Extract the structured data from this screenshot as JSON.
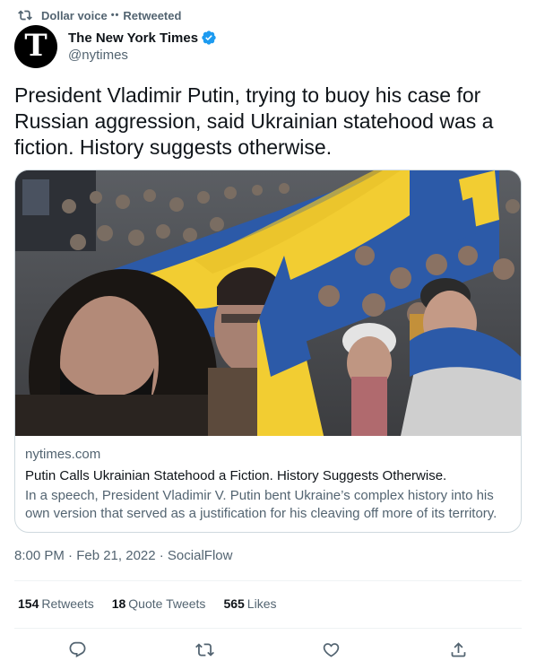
{
  "retweet_context": {
    "icon": "retweet-icon",
    "user": "Dollar voice",
    "emoji": "••",
    "label": "Retweeted"
  },
  "author": {
    "avatar_letter": "T",
    "name": "The New York Times",
    "verified_icon": "verified-badge-icon",
    "handle": "@nytimes"
  },
  "tweet": {
    "text": "President Vladimir Putin, trying to buoy his case for Russian aggression, said Ukrainian statehood was a fiction. History suggests otherwise."
  },
  "card": {
    "image_description": "Crowd carrying a large blue and yellow Ukrainian flag",
    "domain": "nytimes.com",
    "title": "Putin Calls Ukrainian Statehood a Fiction. History Suggests Otherwise.",
    "description": "In a speech, President Vladimir V. Putin bent Ukraine’s complex history into his own version that served as a justification for his cleaving off more of its territory."
  },
  "meta": {
    "time": "8:00 PM · Feb 21, 2022 · SocialFlow"
  },
  "stats": {
    "retweets_count": "154",
    "retweets_label": "Retweets",
    "quotes_count": "18",
    "quotes_label": "Quote Tweets",
    "likes_count": "565",
    "likes_label": "Likes"
  },
  "actions": [
    "reply-icon",
    "retweet-icon",
    "like-icon",
    "share-icon"
  ],
  "colors": {
    "text_primary": "#0f1419",
    "text_secondary": "#536471",
    "verified_blue": "#1d9bf0",
    "border": "#cfd9de",
    "flag_blue": "#2c5aa8",
    "flag_yellow": "#f2cd32"
  }
}
